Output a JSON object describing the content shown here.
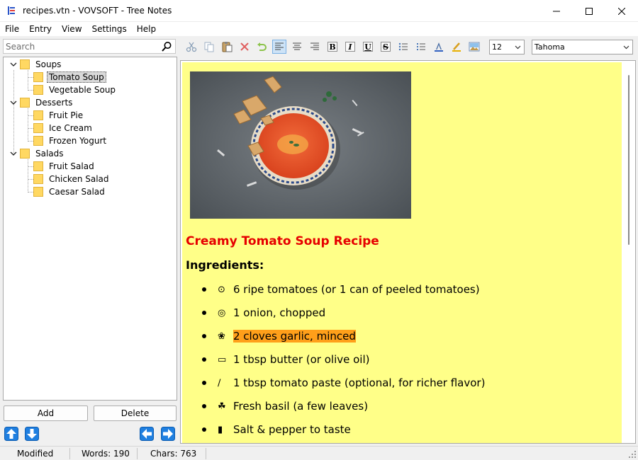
{
  "window": {
    "title": "recipes.vtn - VOVSOFT - Tree Notes"
  },
  "menu": [
    "File",
    "Entry",
    "View",
    "Settings",
    "Help"
  ],
  "search": {
    "placeholder": "Search",
    "value": ""
  },
  "tree": {
    "selected": "Tomato Soup",
    "groups": [
      {
        "label": "Soups",
        "expanded": true,
        "items": [
          "Tomato Soup",
          "Vegetable Soup"
        ]
      },
      {
        "label": "Desserts",
        "expanded": true,
        "items": [
          "Fruit Pie",
          "Ice Cream",
          "Frozen Yogurt"
        ]
      },
      {
        "label": "Salads",
        "expanded": true,
        "items": [
          "Fruit Salad",
          "Chicken Salad",
          "Caesar Salad"
        ]
      }
    ]
  },
  "buttons": {
    "add": "Add",
    "delete": "Delete"
  },
  "toolbar": {
    "font_size": "12",
    "font_name": "Tahoma",
    "icons": [
      "cut-icon",
      "copy-icon",
      "paste-icon",
      "delete-icon",
      "undo-icon",
      "align-left-icon",
      "align-center-icon",
      "align-right-icon",
      "bold-icon",
      "italic-icon",
      "underline-icon",
      "strikethrough-icon",
      "bullet-list-icon",
      "numbered-list-icon",
      "font-color-icon",
      "highlight-icon",
      "insert-image-icon"
    ],
    "bold_label": "B",
    "italic_label": "I",
    "underline_label": "U",
    "strike_label": "S"
  },
  "editor": {
    "background": "#ffff88",
    "title": "Creamy Tomato Soup Recipe",
    "title_color": "#e60000",
    "ingredients_heading": "Ingredients:",
    "highlight_color": "#ff9f1a",
    "ingredients": [
      {
        "icon": "tomato-icon",
        "glyph": "⊙",
        "text": "6 ripe tomatoes (or 1 can of peeled tomatoes)",
        "highlight": false
      },
      {
        "icon": "onion-icon",
        "glyph": "◎",
        "text": "1 onion, chopped",
        "highlight": false
      },
      {
        "icon": "garlic-icon",
        "glyph": "❀",
        "text": "2 cloves garlic, minced",
        "highlight": true
      },
      {
        "icon": "butter-icon",
        "glyph": "▭",
        "text": "1 tbsp butter (or olive oil)",
        "highlight": false
      },
      {
        "icon": "spoon-icon",
        "glyph": "∕",
        "text": "1 tbsp tomato paste (optional, for richer flavor)",
        "highlight": false
      },
      {
        "icon": "herb-icon",
        "glyph": "☘",
        "text": "Fresh basil (a few leaves)",
        "highlight": false
      },
      {
        "icon": "salt-shaker-icon",
        "glyph": "▮",
        "text": "Salt & pepper to taste",
        "highlight": false
      }
    ]
  },
  "status": {
    "state": "Modified",
    "words": "Words: 190",
    "chars": "Chars: 763"
  }
}
